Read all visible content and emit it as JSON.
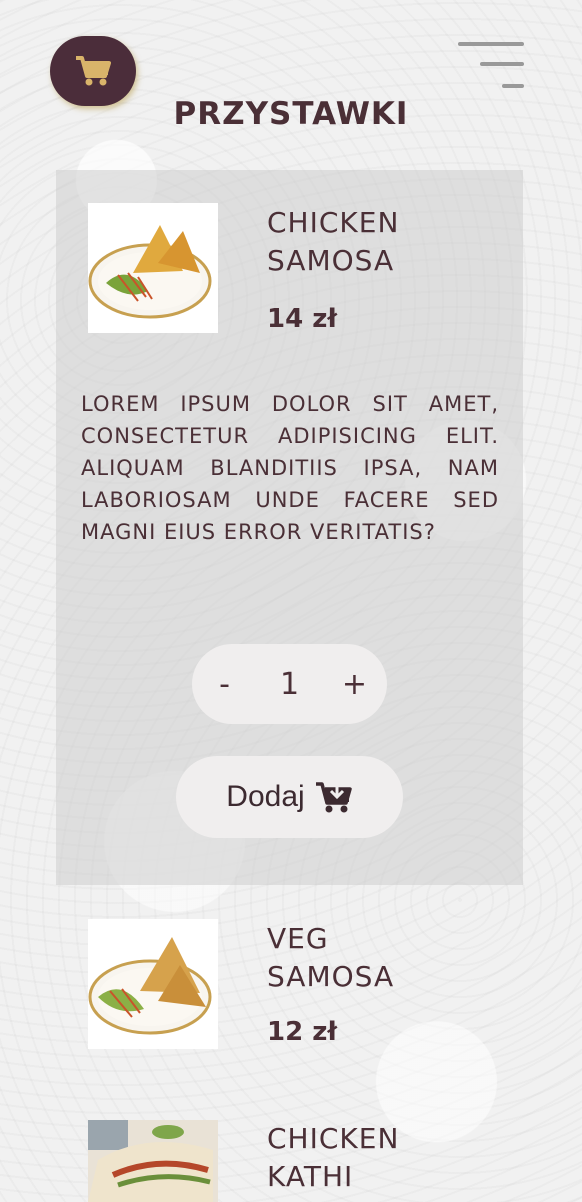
{
  "header": {
    "title": "PRZYSTAWKI",
    "cart_icon": "cart-icon",
    "menu_icon": "hamburger-menu-icon"
  },
  "products": [
    {
      "name_line1": "CHICKEN",
      "name_line2": "SAMOSA",
      "price": "14 zł",
      "description": "LOREM IPSUM DOLOR SIT AMET, CONSECTETUR ADIPISICING ELIT. ALIQUAM BLANDITIIS IPSA, NAM LABORIOSAM UNDE FACERE SED MAGNI EIUS ERROR VERITATIS?",
      "quantity": "1",
      "minus_label": "-",
      "plus_label": "+",
      "add_label": "Dodaj"
    },
    {
      "name_line1": "VEG",
      "name_line2": "SAMOSA",
      "price": "12 zł"
    },
    {
      "name_line1": "CHICKEN",
      "name_line2": "KATHI"
    }
  ],
  "colors": {
    "accent": "#4b2d3a",
    "cart_icon": "#d9b46a",
    "text": "#4a2f36"
  }
}
